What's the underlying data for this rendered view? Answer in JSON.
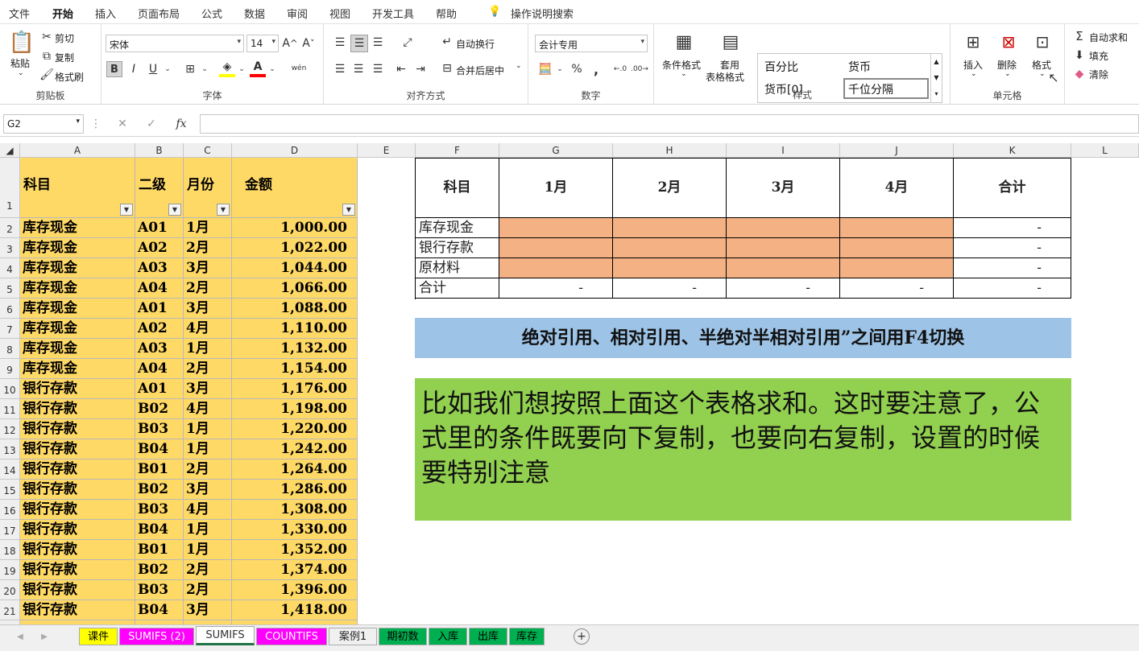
{
  "menu": {
    "items": [
      "文件",
      "开始",
      "插入",
      "页面布局",
      "公式",
      "数据",
      "审阅",
      "视图",
      "开发工具",
      "帮助"
    ],
    "active": "开始",
    "search": "操作说明搜索"
  },
  "ribbon": {
    "clipboard": {
      "label": "剪贴板",
      "paste": "粘贴",
      "cut": "剪切",
      "copy": "复制",
      "painter": "格式刷"
    },
    "font": {
      "label": "字体",
      "name": "宋体",
      "size": "14",
      "bold": "B",
      "italic": "I",
      "underline": "U",
      "wen": "wén"
    },
    "align": {
      "label": "对齐方式",
      "wrap": "自动换行",
      "merge": "合并后居中"
    },
    "number": {
      "label": "数字",
      "format": "会计专用",
      "percent": "%",
      "comma": ","
    },
    "styles": {
      "label": "样式",
      "cond": "条件格式",
      "table1": "套用",
      "table2": "表格格式",
      "cells": [
        "百分比",
        "货币",
        "货币[0]",
        "千位分隔"
      ]
    },
    "cells": {
      "label": "单元格",
      "insert": "插入",
      "delete": "删除",
      "format": "格式"
    },
    "edit": {
      "autosum": "自动求和",
      "fill": "填充",
      "clear": "清除"
    }
  },
  "formula": {
    "namebox": "G2",
    "fx": "fx",
    "value": ""
  },
  "columns": [
    "A",
    "B",
    "C",
    "D",
    "E",
    "F",
    "G",
    "H",
    "I",
    "J",
    "K",
    "L"
  ],
  "left_headers": [
    "科目",
    "二级",
    "月份",
    "金额"
  ],
  "left_rows": [
    [
      "库存现金",
      "A01",
      "1月",
      "1,000.00"
    ],
    [
      "库存现金",
      "A02",
      "2月",
      "1,022.00"
    ],
    [
      "库存现金",
      "A03",
      "3月",
      "1,044.00"
    ],
    [
      "库存现金",
      "A04",
      "2月",
      "1,066.00"
    ],
    [
      "库存现金",
      "A01",
      "3月",
      "1,088.00"
    ],
    [
      "库存现金",
      "A02",
      "4月",
      "1,110.00"
    ],
    [
      "库存现金",
      "A03",
      "1月",
      "1,132.00"
    ],
    [
      "库存现金",
      "A04",
      "2月",
      "1,154.00"
    ],
    [
      "银行存款",
      "A01",
      "3月",
      "1,176.00"
    ],
    [
      "银行存款",
      "B02",
      "4月",
      "1,198.00"
    ],
    [
      "银行存款",
      "B03",
      "1月",
      "1,220.00"
    ],
    [
      "银行存款",
      "B04",
      "1月",
      "1,242.00"
    ],
    [
      "银行存款",
      "B01",
      "2月",
      "1,264.00"
    ],
    [
      "银行存款",
      "B02",
      "3月",
      "1,286.00"
    ],
    [
      "银行存款",
      "B03",
      "4月",
      "1,308.00"
    ],
    [
      "银行存款",
      "B04",
      "1月",
      "1,330.00"
    ],
    [
      "银行存款",
      "B01",
      "1月",
      "1,352.00"
    ],
    [
      "银行存款",
      "B02",
      "2月",
      "1,374.00"
    ],
    [
      "银行存款",
      "B03",
      "2月",
      "1,396.00"
    ],
    [
      "银行存款",
      "B04",
      "3月",
      "1,418.00"
    ]
  ],
  "summary": {
    "headers": [
      "科目",
      "1月",
      "2月",
      "3月",
      "4月",
      "合计"
    ],
    "rows": [
      {
        "label": "库存现金",
        "values": [
          "",
          "",
          "",
          "",
          "-"
        ]
      },
      {
        "label": "银行存款",
        "values": [
          "",
          "",
          "",
          "",
          "-"
        ]
      },
      {
        "label": "原材料",
        "values": [
          "",
          "",
          "",
          "",
          "-"
        ]
      },
      {
        "label": "合计",
        "values": [
          "-",
          "-",
          "-",
          "-",
          "-"
        ]
      }
    ]
  },
  "note_blue": "绝对引用、相对引用、半绝对半相对引用”之间用F4切换",
  "note_green": "比如我们想按照上面这个表格求和。这时要注意了，公式里的条件既要向下复制，也要向右复制，设置的时候要特别注意",
  "sheets": [
    {
      "name": "课件",
      "color": "#ffff00",
      "text": "#000"
    },
    {
      "name": "SUMIFS (2)",
      "color": "#ff00ff",
      "text": "#fff"
    },
    {
      "name": "SUMIFS",
      "color": "#ffffff",
      "text": "#333"
    },
    {
      "name": "COUNTIFS",
      "color": "#ff00ff",
      "text": "#fff"
    },
    {
      "name": "案例1",
      "color": "#f0f0f0",
      "text": "#222"
    },
    {
      "name": "期初数",
      "color": "#00b050",
      "text": "#000"
    },
    {
      "name": "入库",
      "color": "#00b050",
      "text": "#000"
    },
    {
      "name": "出库",
      "color": "#00b050",
      "text": "#000"
    },
    {
      "name": "库存",
      "color": "#00b050",
      "text": "#000"
    }
  ],
  "colors": {
    "yellow": "#ffd966",
    "orange": "#f4b183",
    "blue": "#9dc3e6",
    "green": "#92d050",
    "excel": "#217346"
  }
}
